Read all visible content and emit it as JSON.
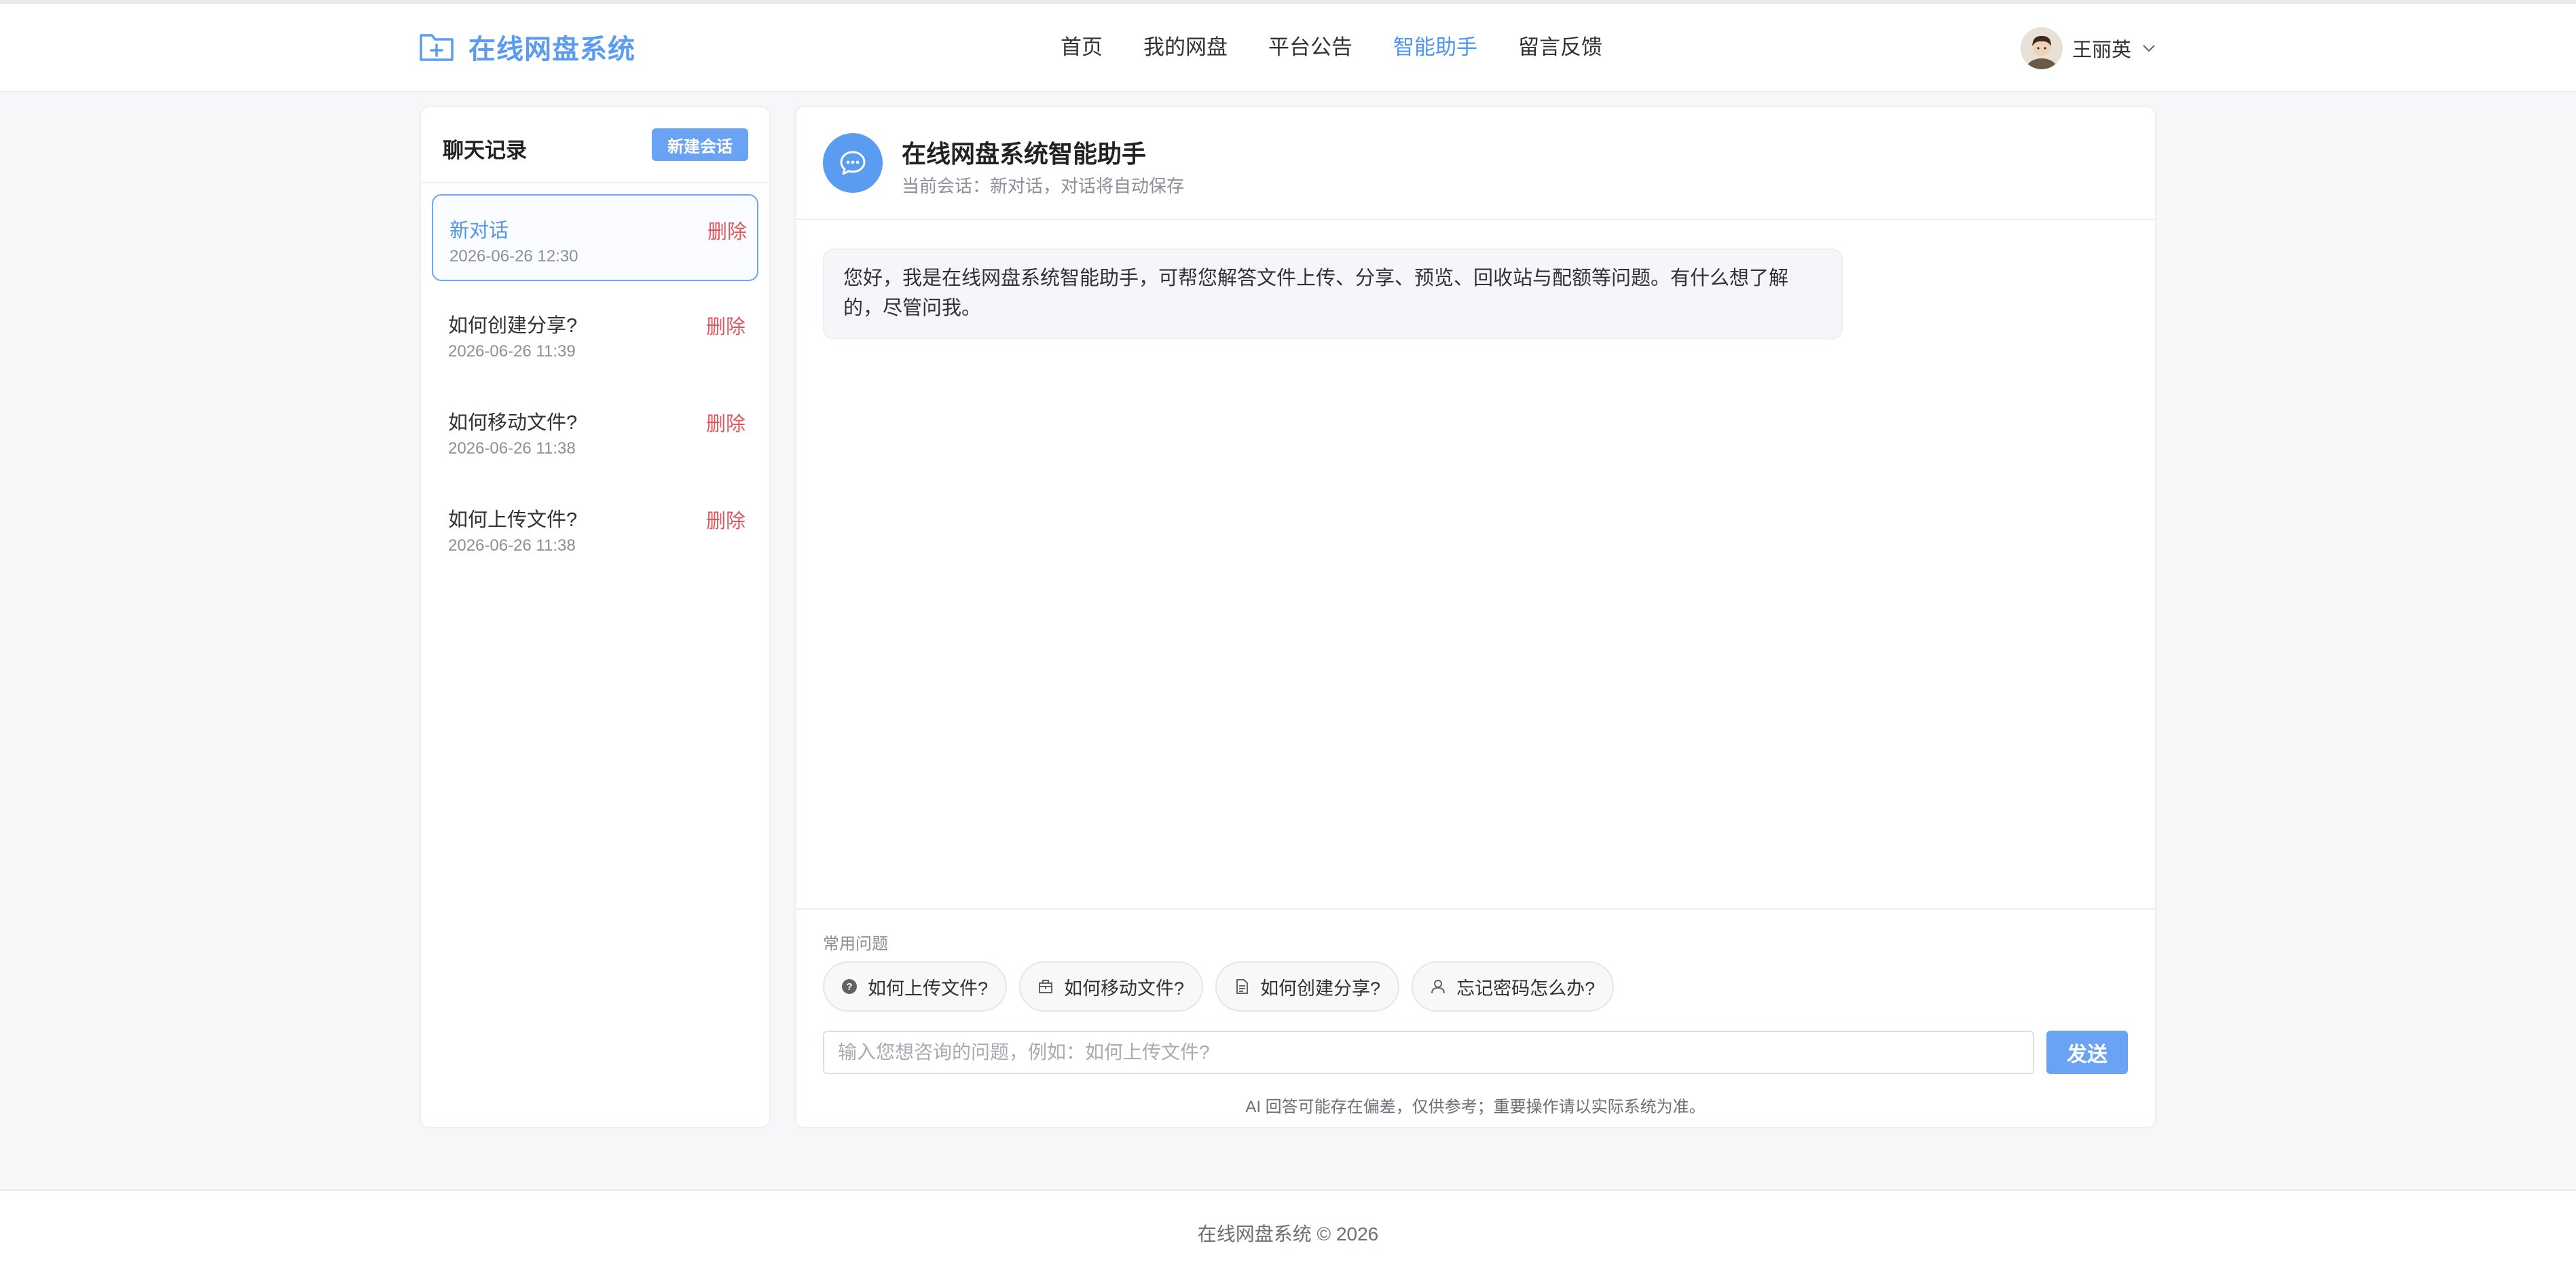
{
  "app": {
    "brand": "在线网盘系统",
    "colors": {
      "accent": "#4f94ee",
      "button": "#6aa3f4",
      "danger": "#e0565b"
    }
  },
  "nav": {
    "items": [
      {
        "label": "首页",
        "active": false
      },
      {
        "label": "我的网盘",
        "active": false
      },
      {
        "label": "平台公告",
        "active": false
      },
      {
        "label": "智能助手",
        "active": true
      },
      {
        "label": "留言反馈",
        "active": false
      }
    ]
  },
  "user": {
    "name": "王丽英",
    "icon": "chevron-down-icon"
  },
  "sidebar": {
    "title": "聊天记录",
    "new_button": "新建会话",
    "delete_label": "删除",
    "conversations": [
      {
        "title": "新对话",
        "time": "2026-06-26 12:30",
        "active": true
      },
      {
        "title": "如何创建分享?",
        "time": "2026-06-26 11:39",
        "active": false
      },
      {
        "title": "如何移动文件?",
        "time": "2026-06-26 11:38",
        "active": false
      },
      {
        "title": "如何上传文件?",
        "time": "2026-06-26 11:38",
        "active": false
      }
    ]
  },
  "chat": {
    "title": "在线网盘系统智能助手",
    "subtitle": "当前会话：新对话，对话将自动保存",
    "messages": [
      {
        "role": "assistant",
        "text": "您好，我是在线网盘系统智能助手，可帮您解答文件上传、分享、预览、回收站与配额等问题。有什么想了解的，尽管问我。"
      }
    ],
    "faq_label": "常用问题",
    "faq": [
      {
        "label": "如何上传文件?",
        "icon": "question-icon"
      },
      {
        "label": "如何移动文件?",
        "icon": "box-icon"
      },
      {
        "label": "如何创建分享?",
        "icon": "document-icon"
      },
      {
        "label": "忘记密码怎么办?",
        "icon": "user-icon"
      }
    ],
    "input": {
      "value": "",
      "placeholder": "输入您想咨询的问题，例如：如何上传文件?"
    },
    "send_label": "发送",
    "disclaimer": "AI 回答可能存在偏差，仅供参考；重要操作请以实际系统为准。"
  },
  "footer": {
    "copy": "在线网盘系统 © 2026"
  }
}
